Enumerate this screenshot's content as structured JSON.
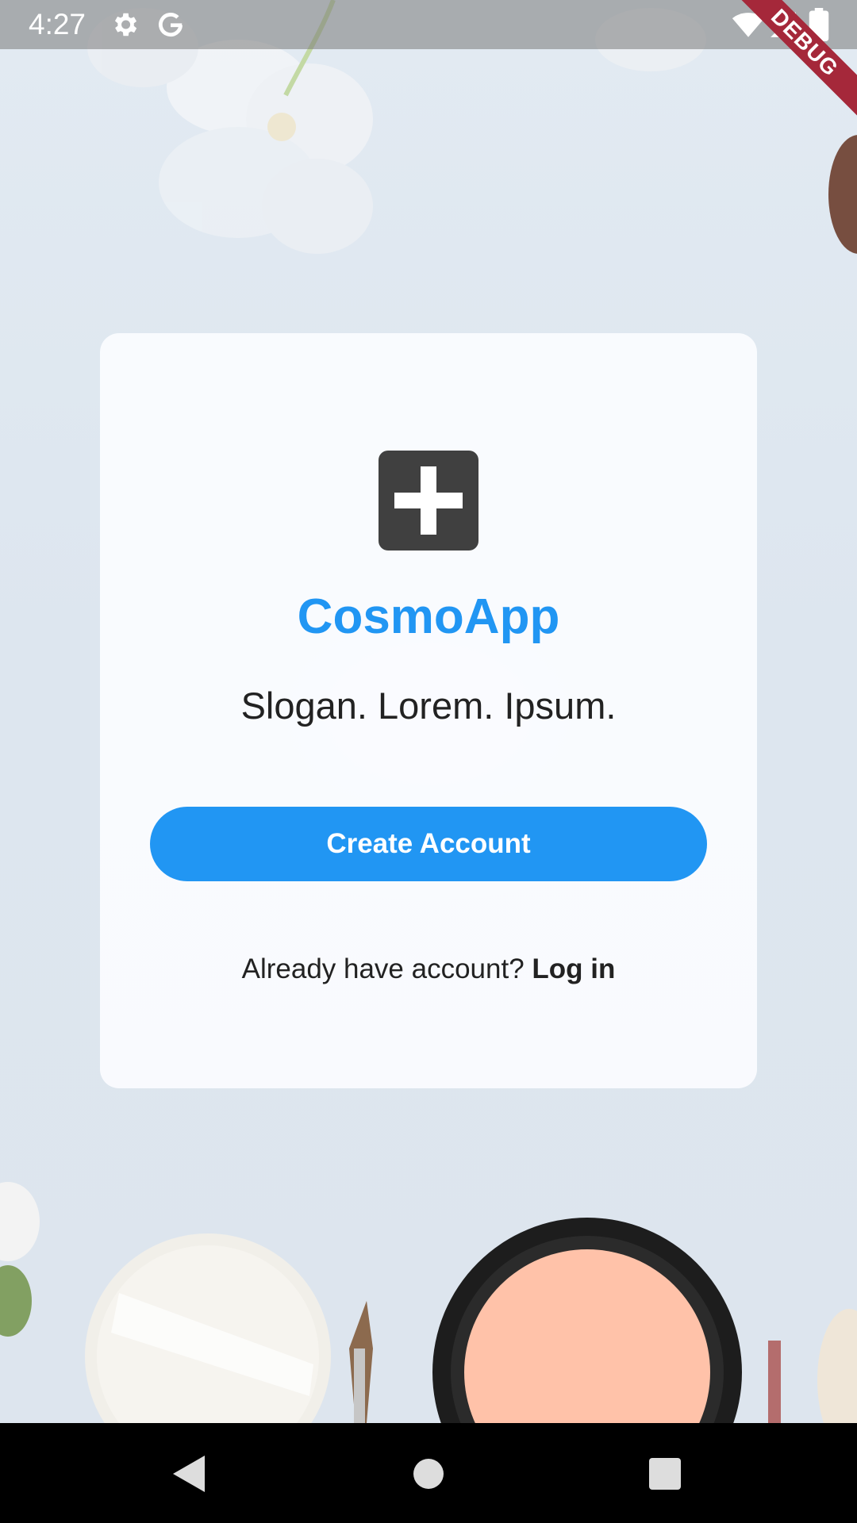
{
  "status_bar": {
    "time": "4:27",
    "icons": [
      "settings-icon",
      "google-icon",
      "wifi-icon",
      "signal-icon",
      "battery-icon"
    ],
    "debug_label": "DEBUG"
  },
  "card": {
    "logo_icon": "medical-cross-icon",
    "app_name": "CosmoApp",
    "slogan": "Slogan. Lorem. Ipsum.",
    "create_account_label": "Create Account",
    "login_prompt": "Already have account?",
    "login_link": "Log in"
  },
  "nav_bar": {
    "buttons": [
      "back-icon",
      "home-icon",
      "recents-icon"
    ]
  },
  "colors": {
    "accent": "#2196f3",
    "debug": "#a5283a",
    "logo": "#404040"
  }
}
